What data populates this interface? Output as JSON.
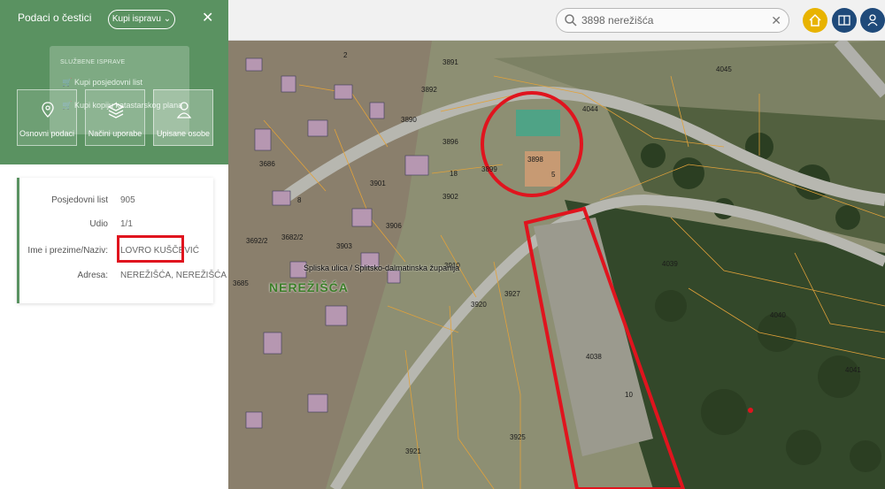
{
  "search": {
    "value": "3898 nerežišća",
    "clear_label": "✕"
  },
  "panel": {
    "title": "Podaci o čestici",
    "buy_button": "Kupi ispravu",
    "close": "✕",
    "dropdown": {
      "heading": "SLUŽBENE ISPRAVE",
      "items": [
        "Kupi posjedovni list",
        "Kupi kopiju katastarskog plana"
      ]
    },
    "tiles": [
      "Osnovni podaci",
      "Načini uporabe",
      "Upisane osobe"
    ]
  },
  "owner": {
    "rows": [
      {
        "key": "Posjedovni list",
        "value": "905"
      },
      {
        "key": "Udio",
        "value": "1/1"
      },
      {
        "key": "Ime i prezime/Naziv:",
        "value": "LOVRO KUŠČEVIĆ"
      },
      {
        "key": "Adresa:",
        "value": "NEREŽIŠĆA, NEREŽIŠĆA"
      }
    ]
  },
  "map": {
    "place_name": "NEREŽIŠĆA",
    "street": "Spliska ulica / Splitsko-dalmatinska županija",
    "plots": [
      "3898",
      "5",
      "4044",
      "4045",
      "3899",
      "4039",
      "4040",
      "4041",
      "4038",
      "10",
      "3927",
      "3925",
      "3921",
      "3920",
      "3910",
      "3906",
      "3903",
      "3901",
      "3902",
      "3896",
      "3891",
      "3892",
      "3890",
      "3686",
      "3685",
      "3682/2",
      "3692/2",
      "2",
      "8",
      "18"
    ]
  },
  "colors": {
    "panel_green": "#5a9261",
    "highlight_red": "#e0141e",
    "home_yellow": "#e8b300",
    "nav_blue": "#1f4a7a"
  }
}
